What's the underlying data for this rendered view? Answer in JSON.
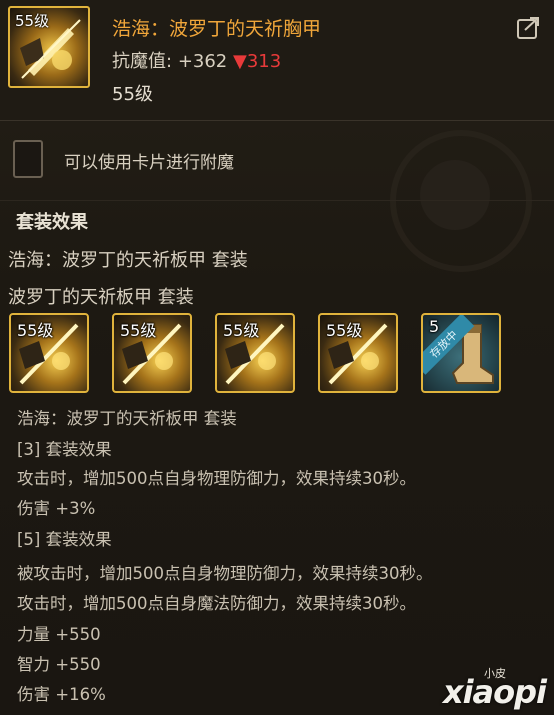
{
  "item": {
    "icon_level": "55级",
    "name": "浩海：波罗丁的天祈胸甲",
    "stat_label": "抗魔值:",
    "stat_value": "+362",
    "stat_compare": "▼313",
    "level": "55级"
  },
  "enchant": {
    "label": "可以使用卡片进行附魔"
  },
  "set": {
    "title": "套装效果",
    "line1": "浩海：波罗丁的天祈板甲  套装",
    "line2": "波罗丁的天祈板甲  套装",
    "slots": [
      {
        "level": "55级"
      },
      {
        "level": "55级"
      },
      {
        "level": "55级"
      },
      {
        "level": "55级"
      },
      {
        "level": "5",
        "badge": "存放中"
      }
    ],
    "details": [
      "浩海：波罗丁的天祈板甲  套装",
      "[3] 套装效果",
      "攻击时，增加500点自身物理防御力，效果持续30秒。",
      "伤害 +3%",
      "[5] 套装效果",
      "被攻击时，增加500点自身物理防御力，效果持续30秒。",
      "攻击时，增加500点自身魔法防御力，效果持续30秒。",
      "力量 +550",
      "智力 +550",
      "伤害 +16%"
    ]
  },
  "watermark": {
    "small": "小皮",
    "big": "xiaopi"
  },
  "icons": {
    "share": "share-icon",
    "armor": "armor-icon",
    "boot": "boot-icon"
  },
  "colors": {
    "item_name": "#f0a63a",
    "stat_down": "#e83a3a",
    "frame_gold": "#e0b33c"
  }
}
